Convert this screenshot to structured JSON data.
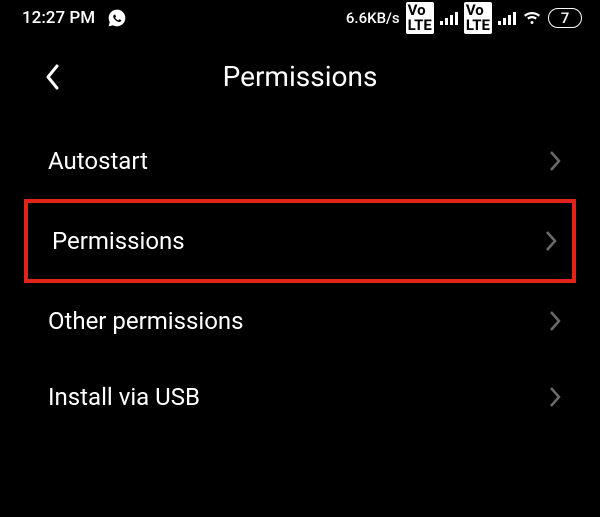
{
  "status_bar": {
    "time": "12:27 PM",
    "network_speed": "6.6KB/s",
    "battery_level": "7"
  },
  "header": {
    "title": "Permissions"
  },
  "menu": {
    "items": [
      {
        "label": "Autostart"
      },
      {
        "label": "Permissions"
      },
      {
        "label": "Other permissions"
      },
      {
        "label": "Install via USB"
      }
    ]
  }
}
